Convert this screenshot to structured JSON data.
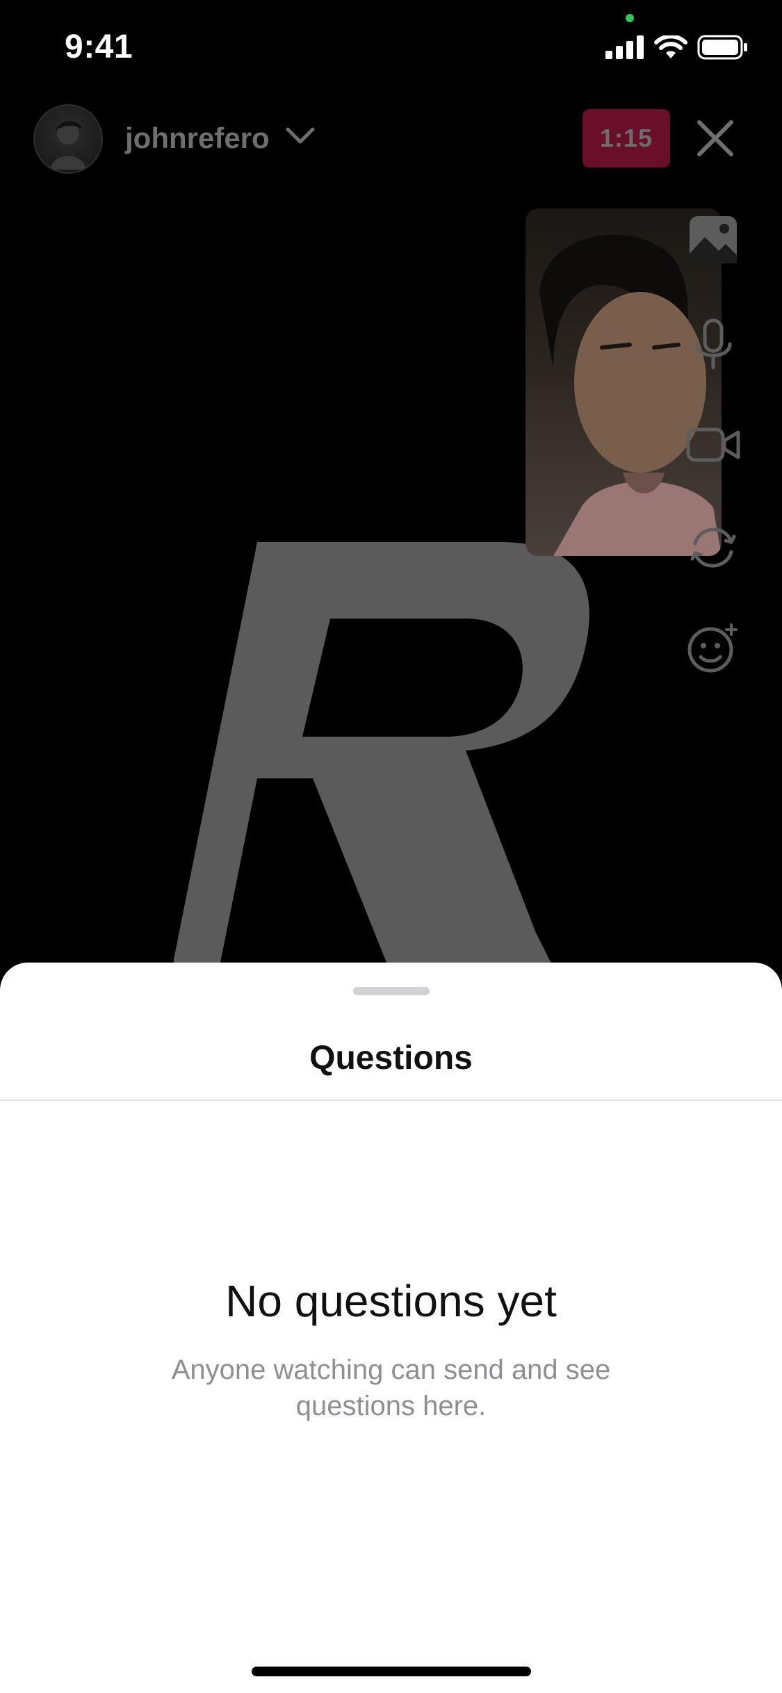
{
  "status_bar": {
    "time": "9:41"
  },
  "header": {
    "username": "johnrefero",
    "timer": "1:15"
  },
  "right_rail": {
    "icons": [
      "gallery-icon",
      "microphone-icon",
      "video-camera-icon",
      "flip-camera-icon",
      "effects-icon"
    ]
  },
  "sheet": {
    "title": "Questions",
    "empty_title": "No questions yet",
    "empty_subtitle": "Anyone watching can send and see questions here."
  },
  "colors": {
    "timer_bg": "#6a0f2a",
    "status_dot": "#34c759",
    "sheet_bg": "#ffffff",
    "muted_text": "#8e8e93"
  }
}
